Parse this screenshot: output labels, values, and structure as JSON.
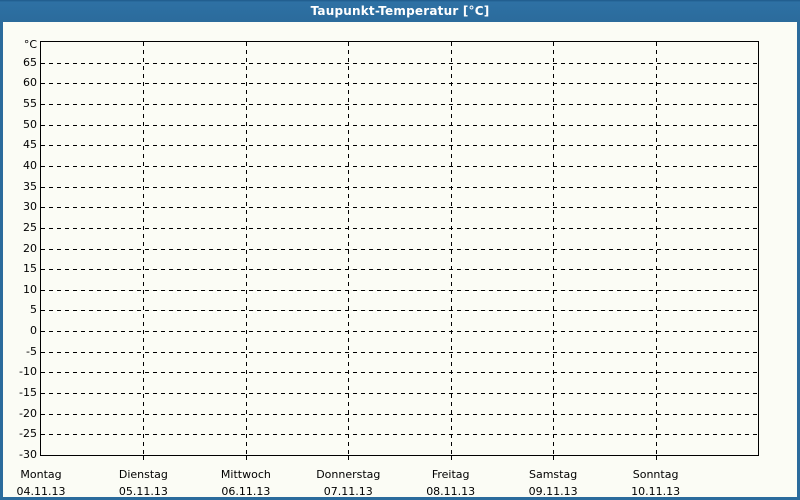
{
  "window": {
    "title": "Taupunkt-Temperatur [°C]",
    "colors": {
      "title_bar": "#2b6b9c",
      "frame": "#2b6b9c",
      "title_text": "#ffffff",
      "background": "#fbfcf5",
      "plot_border": "#000000",
      "grid": "#000000",
      "label_text": "#000000"
    }
  },
  "chart_data": {
    "type": "line",
    "title": "Taupunkt-Temperatur [°C]",
    "xlabel": "",
    "ylabel": "°C",
    "ylim": [
      -30,
      70
    ],
    "ytick_step": 5,
    "ytick_values": [
      65,
      60,
      55,
      50,
      45,
      40,
      35,
      30,
      25,
      20,
      15,
      10,
      5,
      0,
      -5,
      -10,
      -15,
      -20,
      -25,
      -30
    ],
    "x_categories": [
      {
        "day": "Montag",
        "date": "04.11.13"
      },
      {
        "day": "Dienstag",
        "date": "05.11.13"
      },
      {
        "day": "Mittwoch",
        "date": "06.11.13"
      },
      {
        "day": "Donnerstag",
        "date": "07.11.13"
      },
      {
        "day": "Freitag",
        "date": "08.11.13"
      },
      {
        "day": "Samstag",
        "date": "09.11.13"
      },
      {
        "day": "Sonntag",
        "date": "10.11.13"
      }
    ],
    "series": [],
    "grid": "dashed",
    "legend": "none"
  }
}
